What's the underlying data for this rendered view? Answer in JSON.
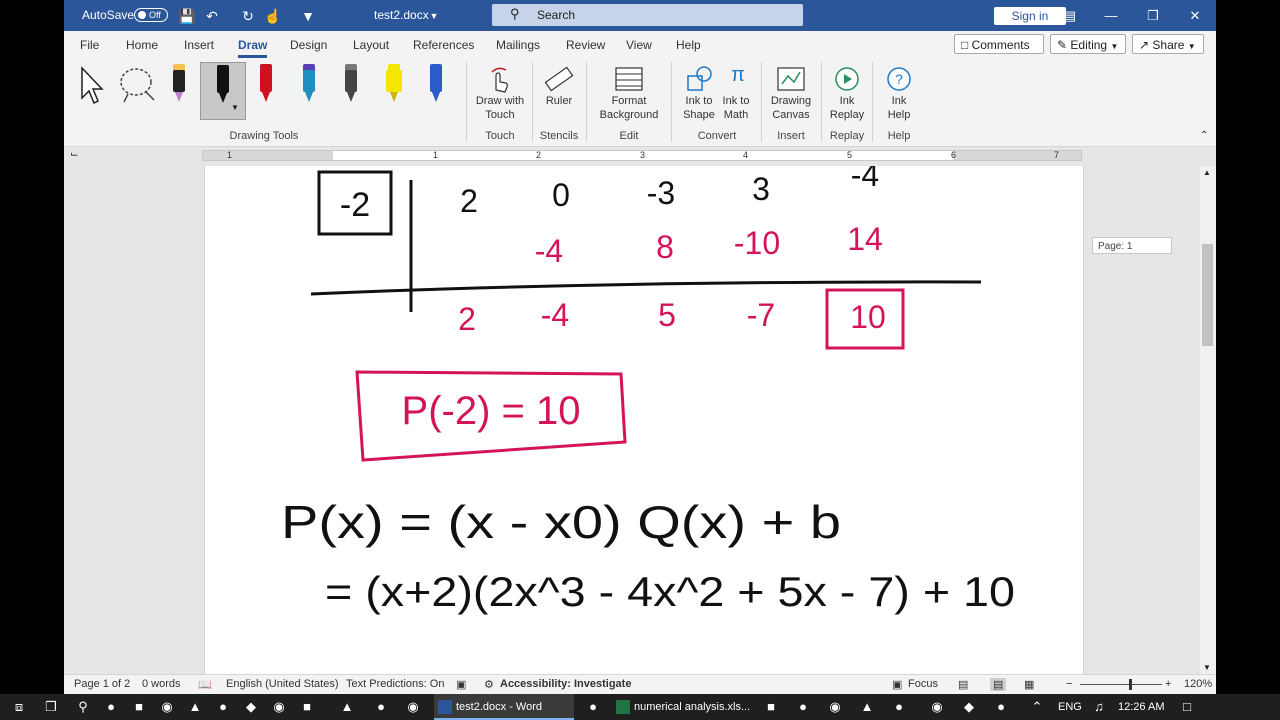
{
  "titlebar": {
    "autosave_label": "AutoSave",
    "autosave_state": "Off",
    "doc_title": "test2.docx",
    "search_placeholder": "Search",
    "signin": "Sign in"
  },
  "menu": {
    "tabs": [
      "File",
      "Home",
      "Insert",
      "Draw",
      "Design",
      "Layout",
      "References",
      "Mailings",
      "Review",
      "View",
      "Help"
    ],
    "active_tab": "Draw",
    "comments": "Comments",
    "editing": "Editing",
    "share": "Share"
  },
  "ribbon": {
    "groups": {
      "drawing_tools": "Drawing Tools",
      "touch": "Touch",
      "stencils": "Stencils",
      "edit": "Edit",
      "convert": "Convert",
      "insert": "Insert",
      "replay": "Replay",
      "help": "Help"
    },
    "buttons": {
      "draw_with_touch_1": "Draw with",
      "draw_with_touch_2": "Touch",
      "ruler": "Ruler",
      "format_bg_1": "Format",
      "format_bg_2": "Background",
      "ink_to_shape_1": "Ink to",
      "ink_to_shape_2": "Shape",
      "ink_to_math_1": "Ink to",
      "ink_to_math_2": "Math",
      "drawing_canvas_1": "Drawing",
      "drawing_canvas_2": "Canvas",
      "ink_replay_1": "Ink",
      "ink_replay_2": "Replay",
      "ink_help_1": "Ink",
      "ink_help_2": "Help"
    },
    "pens": [
      {
        "color": "#222222",
        "cap": "#f2c14e",
        "accent": "#c080d0"
      },
      {
        "color": "#111111",
        "cap": "#111111",
        "accent": "#111111"
      },
      {
        "color": "#d01020",
        "cap": "#d01020",
        "accent": "#d01020"
      },
      {
        "color": "#1f8fbf",
        "cap": "#5a3fb0",
        "accent": "#1f8fbf"
      },
      {
        "color": "#444444",
        "cap": "#777777",
        "accent": "#444444"
      },
      {
        "color": "#f5e600",
        "cap": "#f5e600",
        "accent": "#c9b800"
      },
      {
        "color": "#2a5bc8",
        "cap": "#2a5bc8",
        "accent": "#2a5bc8"
      }
    ]
  },
  "ruler": {
    "numbers": [
      "1",
      "1",
      "2",
      "3",
      "4",
      "5",
      "6",
      "7"
    ]
  },
  "document": {
    "page_tooltip": "Page: 1",
    "ink_colors": {
      "black": "#111111",
      "magenta": "#d4145a"
    },
    "synthetic_division": {
      "divisor": "-2",
      "coefficients": [
        "2",
        "0",
        "-3",
        "3",
        "-4"
      ],
      "products": [
        "-4",
        "8",
        "-10",
        "14"
      ],
      "results": [
        "2",
        "-4",
        "5",
        "-7",
        "10"
      ],
      "remainder_boxed": "10"
    },
    "boxed_result": "P(-2) = 10",
    "equation_line1": "P(x) = (x - x0) Q(x) + b",
    "equation_line2": "= (x+2)(2x^3 - 4x^2 + 5x - 7) + 10"
  },
  "statusbar": {
    "page": "Page 1 of 2",
    "words": "0 words",
    "language": "English (United States)",
    "text_predictions": "Text Predictions: On",
    "accessibility": "Accessibility: Investigate",
    "focus": "Focus",
    "zoom_minus": "−",
    "zoom_plus": "+",
    "zoom": "120%",
    "zoom_level": 0.6
  },
  "taskbar": {
    "word_app": "test2.docx - Word",
    "excel_app": "numerical analysis.xls...",
    "lang": "ENG",
    "time": "12:26 AM"
  }
}
